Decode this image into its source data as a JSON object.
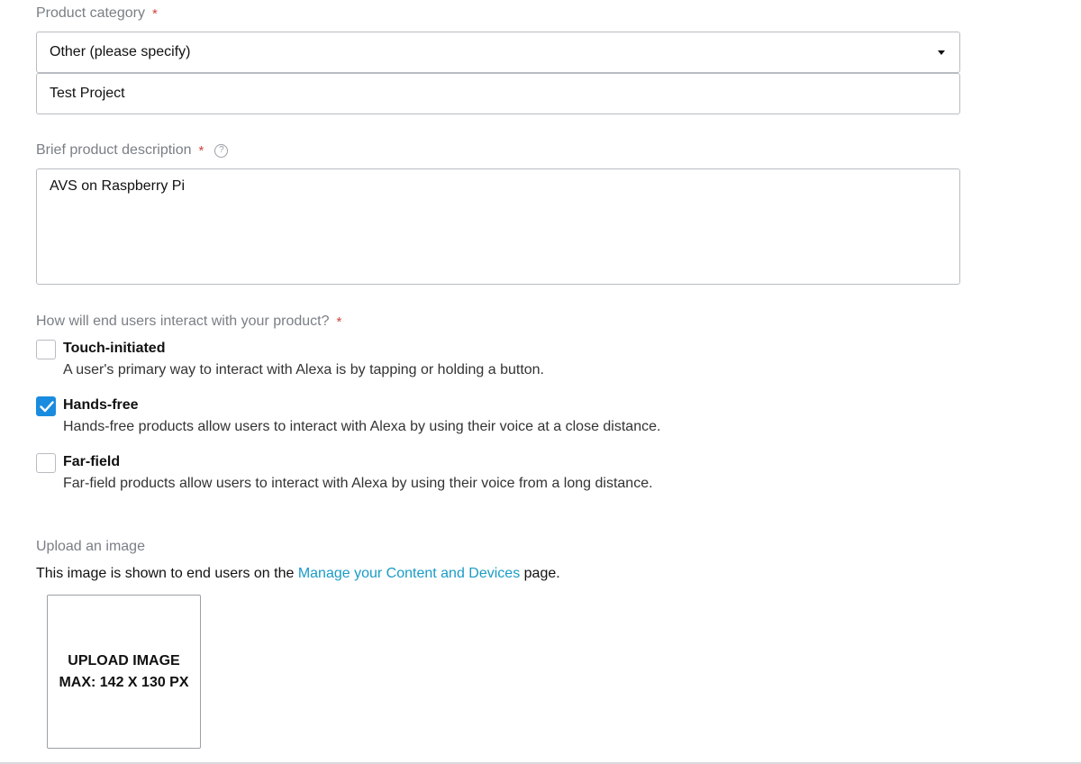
{
  "product_category": {
    "label": "Product category",
    "required_mark": "*",
    "selected": "Other (please specify)",
    "other_value": "Test Project"
  },
  "description": {
    "label": "Brief product description",
    "required_mark": "*",
    "help_icon": "?",
    "value": "AVS on Raspberry Pi"
  },
  "interaction": {
    "label": "How will end users interact with your product?",
    "required_mark": "*",
    "options": [
      {
        "title": "Touch-initiated",
        "desc": "A user's primary way to interact with Alexa is by tapping or holding a button.",
        "checked": false
      },
      {
        "title": "Hands-free",
        "desc": "Hands-free products allow users to interact with Alexa by using their voice at a close distance.",
        "checked": true
      },
      {
        "title": "Far-field",
        "desc": "Far-field products allow users to interact with Alexa by using their voice from a long distance.",
        "checked": false
      }
    ]
  },
  "upload": {
    "label": "Upload an image",
    "desc_before": "This image is shown to end users on the",
    "link_text": "Manage your Content and Devices",
    "desc_after": "page.",
    "button_line1": "UPLOAD IMAGE",
    "button_line2": "MAX: 142 X 130 PX"
  },
  "colors": {
    "accent": "#1a8ce0",
    "link": "#1a9bc6",
    "required": "#d0463b"
  }
}
